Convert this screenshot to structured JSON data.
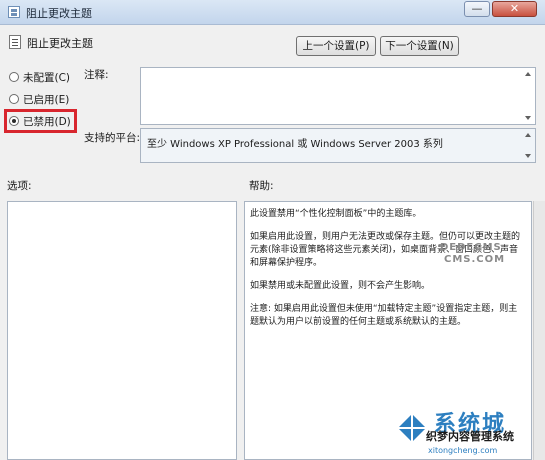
{
  "window": {
    "title": "阻止更改主题",
    "minimize_glyph": "—",
    "close_glyph": "✕"
  },
  "policy": {
    "name": "阻止更改主题"
  },
  "navigation": {
    "prev_label": "上一个设置(P)",
    "next_label": "下一个设置(N)"
  },
  "state": {
    "options": [
      {
        "label": "未配置(C)",
        "checked": false
      },
      {
        "label": "已启用(E)",
        "checked": false
      },
      {
        "label": "已禁用(D)",
        "checked": true
      }
    ]
  },
  "comment": {
    "label": "注释:",
    "value": ""
  },
  "platform": {
    "label": "支持的平台:",
    "value": "至少 Windows XP Professional 或 Windows Server 2003 系列"
  },
  "options_panel": {
    "label": "选项:"
  },
  "help_panel": {
    "label": "帮助:",
    "paragraphs": [
      "此设置禁用“个性化控制面板”中的主题库。",
      "如果启用此设置，则用户无法更改或保存主题。但仍可以更改主题的元素(除非设置策略将这些元素关闭)，如桌面背景、窗口颜色、声音和屏幕保护程序。",
      "如果禁用或未配置此设置，则不会产生影响。",
      "注意: 如果启用此设置但未使用“加载特定主题”设置指定主题，则主题默认为用户以前设置的任何主题或系统默认的主题。"
    ]
  },
  "watermark": {
    "dede_line1": "DEDECMS",
    "dede_line2": "CMS.COM",
    "cn_title": "系统城",
    "cn_subtitle": "织梦内容管理系统",
    "site": "xitongcheng.com"
  },
  "colors": {
    "highlight": "#d8262e",
    "watermark_blue": "#2d7fc0"
  }
}
